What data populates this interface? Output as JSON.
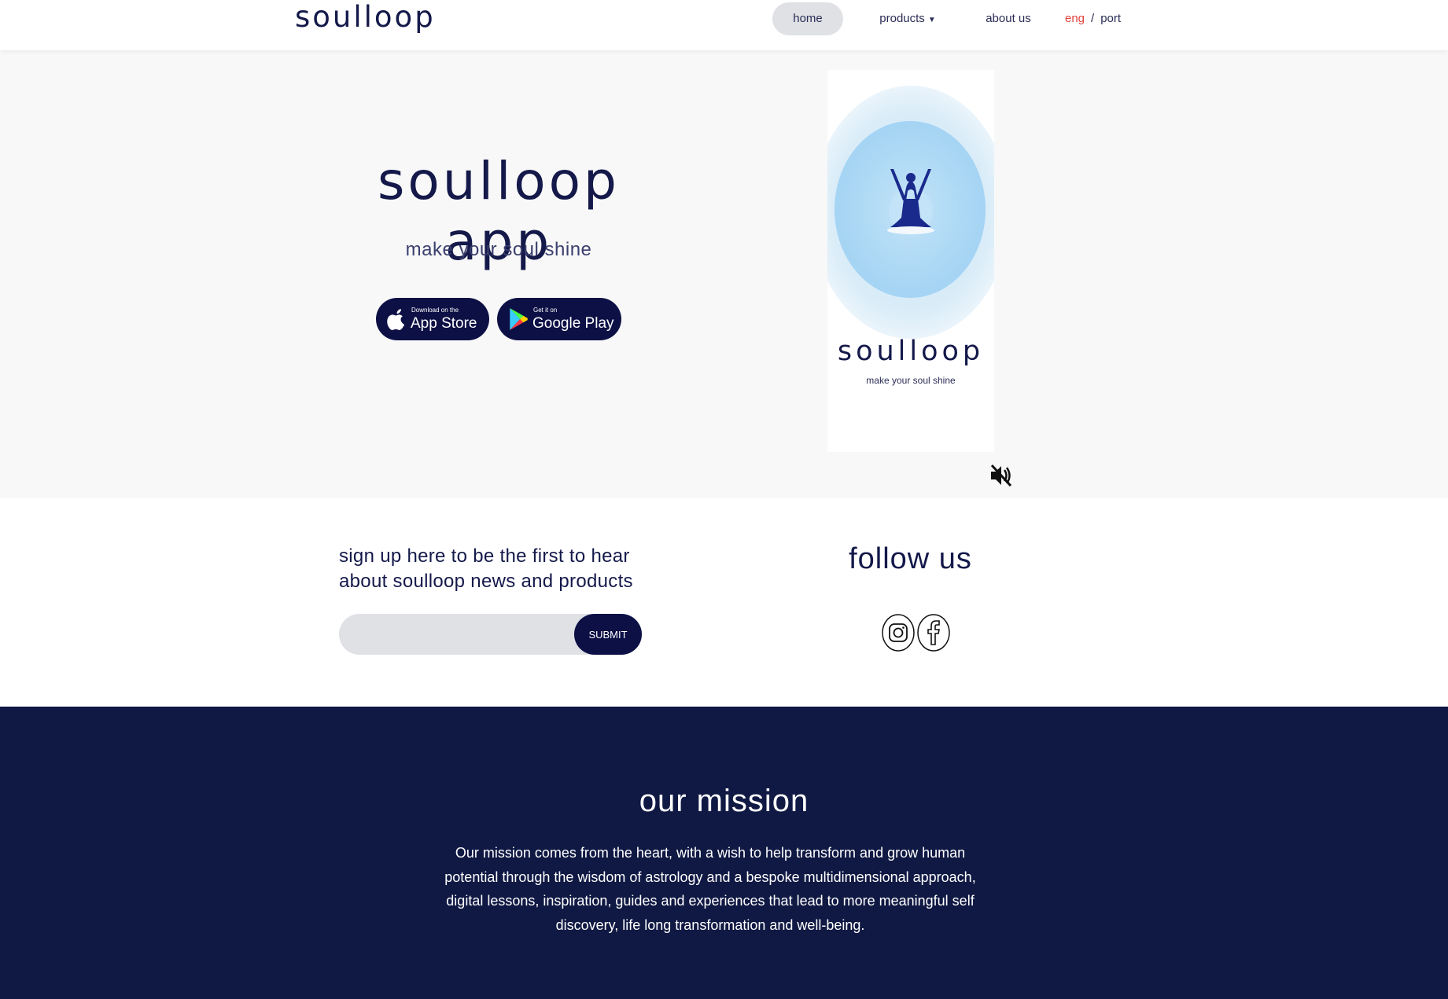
{
  "header": {
    "logo": "soulloop",
    "nav": {
      "home": "home",
      "products": "products",
      "about": "about us"
    },
    "lang": {
      "eng": "eng",
      "separator": "/",
      "port": "port"
    }
  },
  "hero": {
    "title": "soulloop app",
    "tagline": "make your soul shine",
    "app_store": {
      "small": "Download on the",
      "big": "App Store"
    },
    "google_play": {
      "small": "Get it on",
      "big": "Google Play"
    },
    "video": {
      "brand": "soulloop",
      "tagline": "make your soul shine",
      "mute_icon": "speaker-muted-icon"
    }
  },
  "signup": {
    "heading_line1": "sign up here to be the first to hear",
    "heading_line2": "about soulloop news and products",
    "email_value": "",
    "submit": "SUBMIT"
  },
  "follow": {
    "heading": "follow us",
    "icons": [
      "instagram-icon",
      "facebook-icon"
    ]
  },
  "mission": {
    "title": "our mission",
    "text": "Our mission comes from the heart, with a wish to help transform and grow human potential through the wisdom of astrology and a bespoke multidimensional approach, digital lessons, inspiration, guides and experiences that lead to more meaningful self discovery, life long transformation and well-being."
  },
  "colors": {
    "navy": "#0d1045",
    "mission_bg": "#101943",
    "accent_red": "#e3413b",
    "hero_bg": "#f8f8f8",
    "glow_blue": "#a8d6f4"
  }
}
